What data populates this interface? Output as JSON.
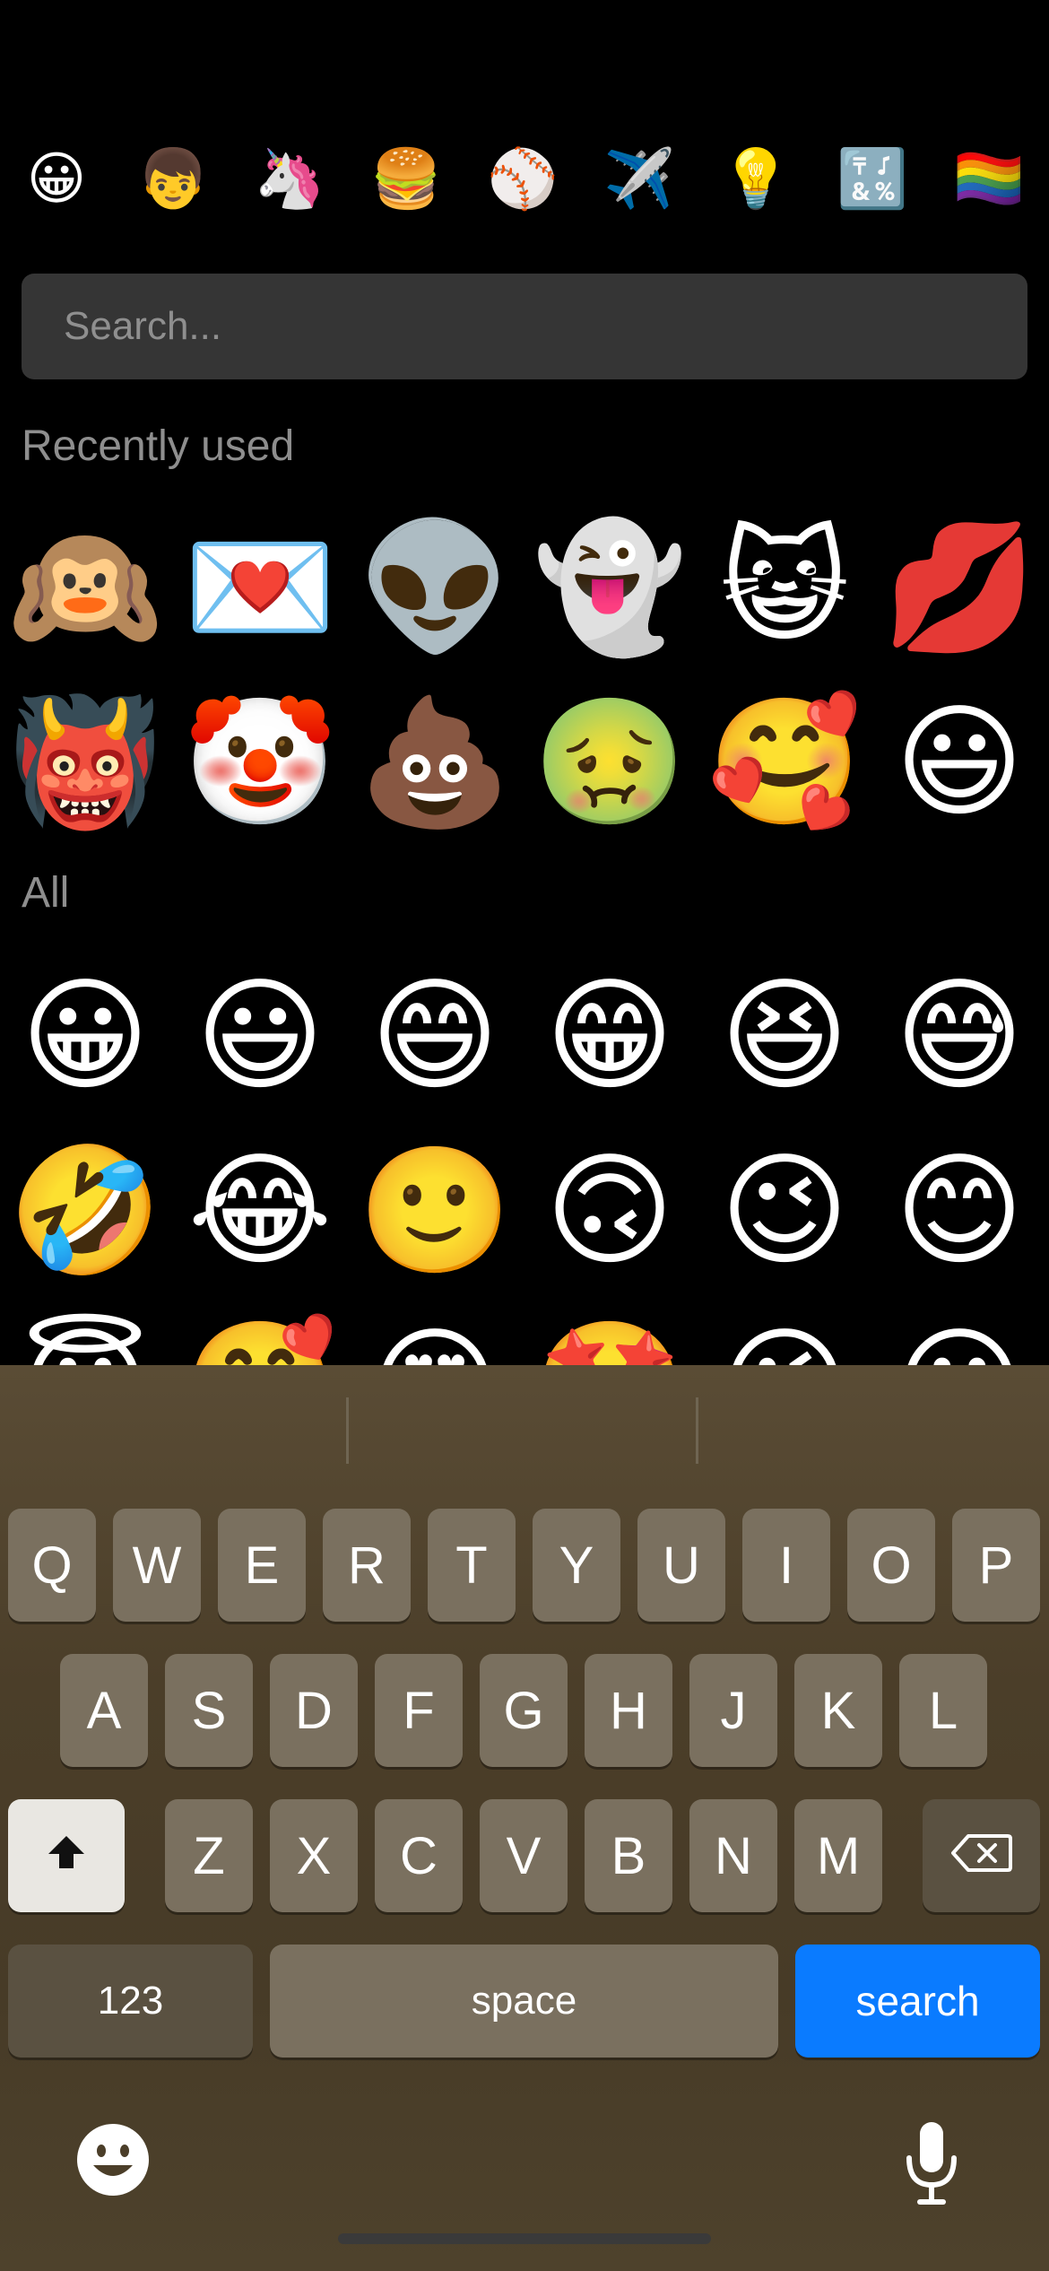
{
  "categories": [
    {
      "name": "smileys-category",
      "glyph": "😀"
    },
    {
      "name": "people-category",
      "glyph": "👦"
    },
    {
      "name": "animals-category",
      "glyph": "🦄"
    },
    {
      "name": "food-category",
      "glyph": "🍔"
    },
    {
      "name": "activity-category",
      "glyph": "⚾"
    },
    {
      "name": "travel-category",
      "glyph": "✈️"
    },
    {
      "name": "objects-category",
      "glyph": "💡"
    },
    {
      "name": "symbols-category",
      "glyph": "🔣"
    },
    {
      "name": "flags-category",
      "glyph": "🏳️‍🌈"
    }
  ],
  "search": {
    "placeholder": "Search..."
  },
  "sections": {
    "recent_title": "Recently used",
    "all_title": "All"
  },
  "recently_used": [
    "🙉",
    "💌",
    "👽",
    "👻",
    "😺",
    "💋",
    "👹",
    "🤡",
    "💩",
    "🤢",
    "🥰",
    "😃"
  ],
  "all": [
    "😀",
    "😃",
    "😄",
    "😁",
    "😆",
    "😅",
    "🤣",
    "😂",
    "🙂",
    "🙃",
    "😉",
    "😊",
    "😇",
    "🥰",
    "😍",
    "🤩",
    "😘",
    "😗"
  ],
  "keyboard": {
    "row1": [
      "Q",
      "W",
      "E",
      "R",
      "T",
      "Y",
      "U",
      "I",
      "O",
      "P"
    ],
    "row2": [
      "A",
      "S",
      "D",
      "F",
      "G",
      "H",
      "J",
      "K",
      "L"
    ],
    "row3": [
      "Z",
      "X",
      "C",
      "V",
      "B",
      "N",
      "M"
    ],
    "numbers_label": "123",
    "space_label": "space",
    "search_label": "search",
    "accent_color": "#0a7bff"
  }
}
